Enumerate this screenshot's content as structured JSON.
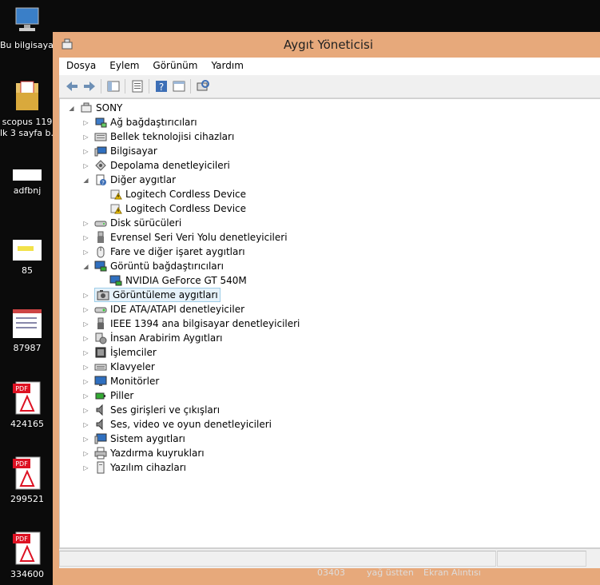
{
  "desktop": {
    "icons": [
      {
        "label": "Bu bilgisayar"
      },
      {
        "label": "scopus 119",
        "label2": "lk 3 sayfa b..."
      },
      {
        "label": "adfbnj"
      },
      {
        "label": "85"
      },
      {
        "label": "87987"
      },
      {
        "label": "424165"
      },
      {
        "label": "299521"
      },
      {
        "label": "334600"
      }
    ],
    "taskbar": [
      "03403",
      "yağ üstten",
      "Ekran Alıntısı"
    ]
  },
  "window": {
    "title": "Aygıt Yöneticisi",
    "menu": [
      "Dosya",
      "Eylem",
      "Görünüm",
      "Yardım"
    ]
  },
  "tree": {
    "root": "SONY",
    "items": [
      {
        "label": "Ağ bağdaştırıcıları",
        "expanded": false
      },
      {
        "label": "Bellek teknolojisi cihazları",
        "expanded": false
      },
      {
        "label": "Bilgisayar",
        "expanded": false
      },
      {
        "label": "Depolama denetleyicileri",
        "expanded": false
      },
      {
        "label": "Diğer aygıtlar",
        "expanded": true
      },
      {
        "label": "Logitech Cordless Device",
        "child": true
      },
      {
        "label": "Logitech Cordless Device",
        "child": true
      },
      {
        "label": "Disk sürücüleri",
        "expanded": false
      },
      {
        "label": "Evrensel Seri Veri Yolu denetleyicileri",
        "expanded": false
      },
      {
        "label": "Fare ve diğer işaret aygıtları",
        "expanded": false
      },
      {
        "label": "Görüntü bağdaştırıcıları",
        "expanded": true
      },
      {
        "label": "NVIDIA GeForce GT 540M",
        "child": true
      },
      {
        "label": "Görüntüleme aygıtları",
        "expanded": false,
        "selected": true
      },
      {
        "label": "IDE ATA/ATAPI denetleyiciler",
        "expanded": false
      },
      {
        "label": "IEEE 1394 ana bilgisayar denetleyicileri",
        "expanded": false
      },
      {
        "label": "İnsan Arabirim Aygıtları",
        "expanded": false
      },
      {
        "label": "İşlemciler",
        "expanded": false
      },
      {
        "label": "Klavyeler",
        "expanded": false
      },
      {
        "label": "Monitörler",
        "expanded": false
      },
      {
        "label": "Piller",
        "expanded": false
      },
      {
        "label": "Ses girişleri ve çıkışları",
        "expanded": false
      },
      {
        "label": "Ses, video ve oyun denetleyicileri",
        "expanded": false
      },
      {
        "label": "Sistem aygıtları",
        "expanded": false
      },
      {
        "label": "Yazdırma kuyrukları",
        "expanded": false
      },
      {
        "label": "Yazılım cihazları",
        "expanded": false
      }
    ]
  }
}
